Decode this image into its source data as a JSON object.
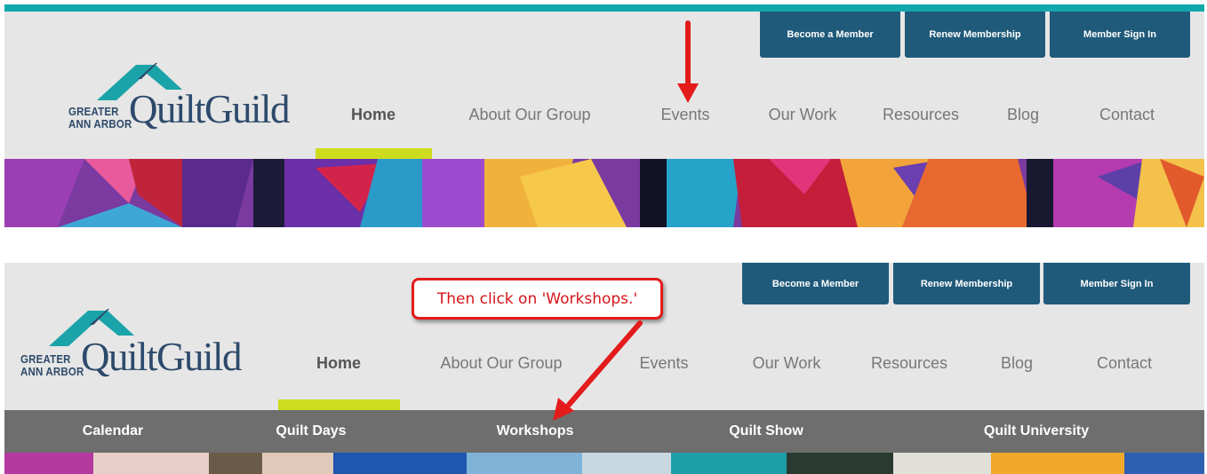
{
  "colors": {
    "top_rule": "#11a8ad",
    "header_bg": "#e6e6e6",
    "member_button_bg": "#1f5a7a",
    "active_indicator": "#cddc1f",
    "submenu_bg": "#6e6e6e",
    "annotation_red": "#e31b1b",
    "logo_teal": "#1aa3a8",
    "logo_navy": "#2d4a6b"
  },
  "before": {
    "member_buttons": [
      "Become a Member",
      "Renew Membership",
      "Member Sign In"
    ],
    "logo": {
      "line1": "GREATER",
      "line2": "ANN ARBOR",
      "name": "QuiltGuild"
    },
    "nav": [
      "Home",
      "About Our Group",
      "Events",
      "Our Work",
      "Resources",
      "Blog",
      "Contact"
    ],
    "active_nav": "Home",
    "annotation_icon": "red-arrow-down-icon"
  },
  "after": {
    "member_buttons": [
      "Become a Member",
      "Renew Membership",
      "Member Sign In"
    ],
    "logo": {
      "line1": "GREATER",
      "line2": "ANN ARBOR",
      "name": "QuiltGuild"
    },
    "nav": [
      "Home",
      "About Our Group",
      "Events",
      "Our Work",
      "Resources",
      "Blog",
      "Contact"
    ],
    "active_nav": "Home",
    "submenu": [
      "Calendar",
      "Quilt Days",
      "Workshops",
      "Quilt Show",
      "Quilt University"
    ],
    "callout": "Then click on 'Workshops.'",
    "annotation_icon": "red-arrow-diagonal-icon"
  }
}
